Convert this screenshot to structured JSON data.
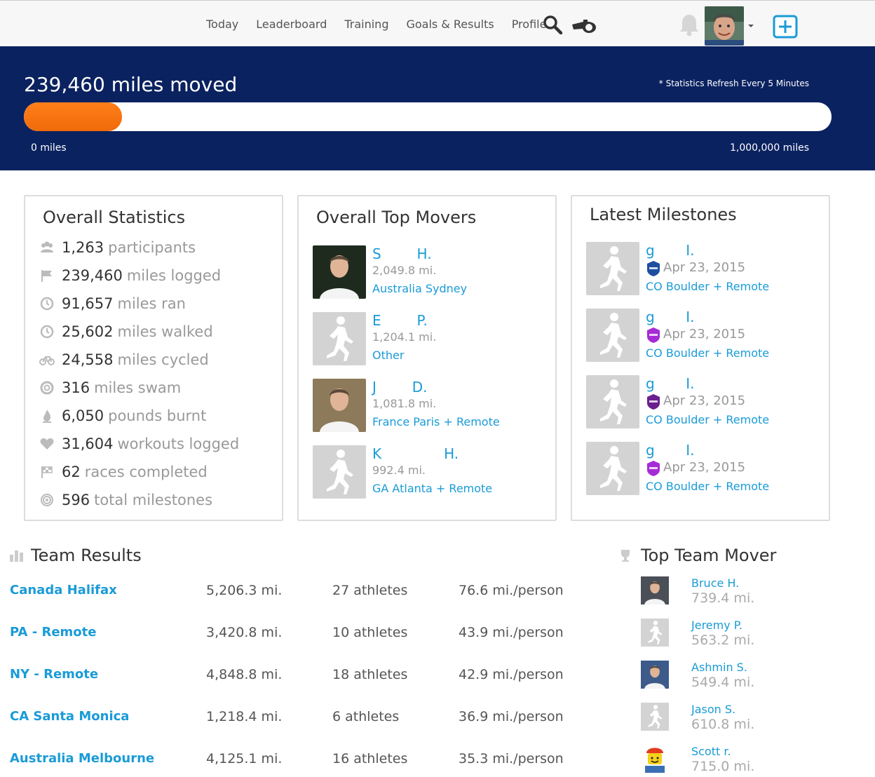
{
  "nav": {
    "links": [
      "Today",
      "Leaderboard",
      "Training",
      "Goals & Results",
      "Profile"
    ],
    "icons": [
      "search-icon",
      "whistle-icon",
      "bell-icon",
      "avatar",
      "caret-down-icon",
      "plus-square-icon"
    ]
  },
  "hero": {
    "title": "239,460 miles moved",
    "note": "* Statistics Refresh Every 5 Minutes",
    "progress_fraction": 0.239,
    "min_label": "0 miles",
    "max_label": "1,000,000 miles",
    "fill_color": "#f47b20",
    "background_color": "#0b2260"
  },
  "overall_statistics": {
    "title": "Overall Statistics",
    "rows": [
      {
        "icon": "users-icon",
        "value": "1,263",
        "unit": "participants"
      },
      {
        "icon": "flag-icon",
        "value": "239,460",
        "unit": "miles logged"
      },
      {
        "icon": "clock-icon",
        "value": "91,657",
        "unit": "miles ran"
      },
      {
        "icon": "clock-icon",
        "value": "25,602",
        "unit": "miles walked"
      },
      {
        "icon": "bicycle-icon",
        "value": "24,558",
        "unit": "miles cycled"
      },
      {
        "icon": "lifebuoy-icon",
        "value": "316",
        "unit": "miles swam"
      },
      {
        "icon": "flame-icon",
        "value": "6,050",
        "unit": "pounds burnt"
      },
      {
        "icon": "heart-icon",
        "value": "31,604",
        "unit": "workouts logged"
      },
      {
        "icon": "checkered-flag-icon",
        "value": "62",
        "unit": "races completed"
      },
      {
        "icon": "target-icon",
        "value": "596",
        "unit": "total milestones"
      }
    ]
  },
  "top_movers": {
    "title": "Overall Top Movers",
    "items": [
      {
        "name": "S        H.",
        "distance": "2,049.8 mi.",
        "team": "Australia Sydney",
        "photo": "photo"
      },
      {
        "name": "E        P.",
        "distance": "1,204.1 mi.",
        "team": "Other",
        "photo": "runner"
      },
      {
        "name": "J        D.",
        "distance": "1,081.8 mi.",
        "team": "France Paris + Remote",
        "photo": "photo"
      },
      {
        "name": "K              H.",
        "distance": "992.4 mi.",
        "team": "GA Atlanta + Remote",
        "photo": "runner"
      }
    ]
  },
  "milestones": {
    "title": "Latest Milestones",
    "items": [
      {
        "name": "g       I.",
        "date": "Apr 23, 2015",
        "team": "CO Boulder + Remote",
        "badge_color": "#1d4ea0"
      },
      {
        "name": "g       I.",
        "date": "Apr 23, 2015",
        "team": "CO Boulder + Remote",
        "badge_color": "#a52bd6"
      },
      {
        "name": "g       I.",
        "date": "Apr 23, 2015",
        "team": "CO Boulder + Remote",
        "badge_color": "#6a1f8f"
      },
      {
        "name": "g       I.",
        "date": "Apr 23, 2015",
        "team": "CO Boulder + Remote",
        "badge_color": "#a52bd6"
      }
    ]
  },
  "team_results": {
    "title": "Team Results",
    "rows": [
      {
        "team": "Canada Halifax",
        "miles": "5,206.3 mi.",
        "athletes": "27 athletes",
        "per_person": "76.6 mi./person"
      },
      {
        "team": "PA - Remote",
        "miles": "3,420.8 mi.",
        "athletes": "10 athletes",
        "per_person": "43.9 mi./person"
      },
      {
        "team": "NY - Remote",
        "miles": "4,848.8 mi.",
        "athletes": "18 athletes",
        "per_person": "42.9 mi./person"
      },
      {
        "team": "CA Santa Monica",
        "miles": "1,218.4 mi.",
        "athletes": "6 athletes",
        "per_person": "36.9 mi./person"
      },
      {
        "team": "Australia Melbourne",
        "miles": "4,125.1 mi.",
        "athletes": "16 athletes",
        "per_person": "35.3 mi./person"
      }
    ]
  },
  "top_team_mover": {
    "title": "Top Team Mover",
    "items": [
      {
        "name": "Bruce H.",
        "distance": "739.4 mi.",
        "photo": "photo"
      },
      {
        "name": "Jeremy P.",
        "distance": "563.2 mi.",
        "photo": "runner"
      },
      {
        "name": "Ashmin S.",
        "distance": "549.4 mi.",
        "photo": "photo"
      },
      {
        "name": "Jason S.",
        "distance": "610.8 mi.",
        "photo": "runner"
      },
      {
        "name": "Scott r.",
        "distance": "715.0 mi.",
        "photo": "lego"
      }
    ]
  },
  "colors": {
    "link": "#1a9bd7",
    "accent_orange": "#f47b20",
    "navy": "#0b2260"
  }
}
